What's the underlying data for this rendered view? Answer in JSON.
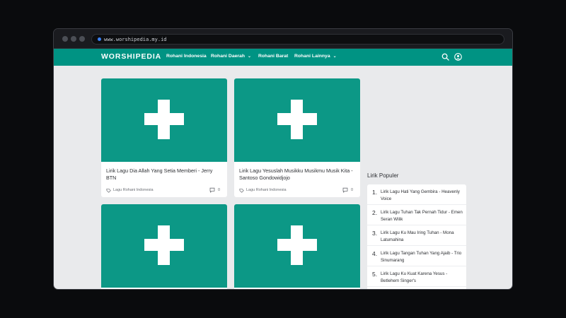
{
  "browser": {
    "url": "www.worshipedia.my.id"
  },
  "nav": {
    "brand": "WORSHIPEDIA",
    "items": [
      {
        "label": "Rohani Indonesia",
        "has_dropdown": false
      },
      {
        "label": "Rohani Daerah",
        "has_dropdown": true
      },
      {
        "label": "Rohani Barat",
        "has_dropdown": false
      },
      {
        "label": "Rohani Lainnya",
        "has_dropdown": true
      }
    ],
    "chevron": "⌄",
    "icons": [
      "search-icon",
      "user-icon"
    ]
  },
  "posts": [
    {
      "title": "Lirik Lagu Dia Allah Yang Setia Memberi - Jerry BTN",
      "category": "Lagu Rohani Indonesia",
      "comments": "0"
    },
    {
      "title": "Lirik Lagu Yesuslah Musikku Musikmu Musik Kita - Santoso Gondowidjojo",
      "category": "Lagu Rohani Indonesia",
      "comments": "0"
    },
    {
      "title": "",
      "category": "",
      "comments": ""
    },
    {
      "title": "",
      "category": "",
      "comments": ""
    }
  ],
  "sidebar": {
    "title": "Lirik Populer",
    "items": [
      {
        "num": "1.",
        "text": "Lirik Lagu Hati Yang Gembira - Heavenly Voice"
      },
      {
        "num": "2.",
        "text": "Lirik Lagu Tuhan Tak Pernah Tidur - Emen Seran Wilik"
      },
      {
        "num": "3.",
        "text": "Lirik Lagu Ku Mau Iring Tuhan - Mona Latumahina"
      },
      {
        "num": "4.",
        "text": "Lirik Lagu Tangan Tuhan Yang Ajaib - Trio Sinumarang"
      },
      {
        "num": "5.",
        "text": "Lirik Lagu Ku Kuat Karena Yesus - Betlehem Singer's"
      }
    ]
  },
  "colors": {
    "brand_teal": "#009383",
    "thumb_teal": "#0c9886",
    "page_bg": "#e9eaec"
  }
}
